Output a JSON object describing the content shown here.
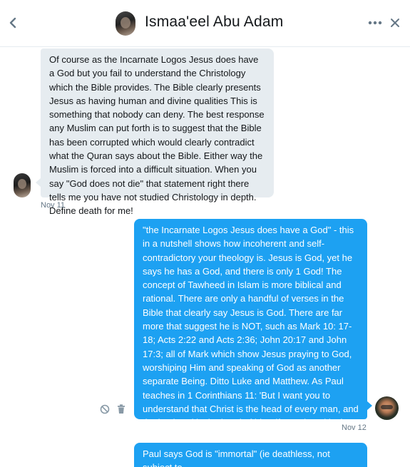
{
  "header": {
    "title": "Ismaa'eel Abu Adam",
    "icons": {
      "back": "chevron-left-icon",
      "more": "more-horizontal-icon",
      "close": "close-icon"
    }
  },
  "messages": [
    {
      "direction": "incoming",
      "text": "Of course as the Incarnate Logos Jesus does have a God but you fail to understand the Christology which the Bible provides.   The Bible clearly presents Jesus as having human and divine qualities This is something that nobody can deny.  The best response any Muslim can put forth is to suggest that the Bible has been corrupted which would clearly contradict what the Quran says about the Bible.  Either way the Muslim is forced into a difficult situation.  When you say \"God does not die\" that statement right there tells me you have not studied Christology in depth. Define death for me!",
      "timestamp": "Nov 11"
    },
    {
      "direction": "outgoing",
      "text": "\"the Incarnate Logos Jesus does have a God\" - this in a nutshell shows how incoherent and self-contradictory your theology is. Jesus is God, yet he says he has a God, and there is only 1 God! The concept of Tawheed in Islam is more biblical and rational. There are only a handful of verses in the Bible that clearly say Jesus is God. There are far more that suggest he is NOT, such as Mark 10: 17-18;  Acts 2:22 and Acts 2:36; John 20:17 and John 17:3; all of Mark which show Jesus praying to God, worshiping Him and speaking of God as another separate Being. Ditto Luke and Matthew. As Paul teaches in 1 Corinthians 11: 'But I want you to understand that Christ is the head of every man, and the husband is the head of his wife, and God is the head of Christ.' Christ is subordinate to God.",
      "timestamp": "Nov 12"
    },
    {
      "direction": "outgoing",
      "text": "Paul says God is \"immortal\" (ie deathless, not subject to"
    }
  ],
  "colors": {
    "accent": "#1da1f2",
    "incoming_bubble": "#e6ecf0",
    "muted_text": "#657786"
  }
}
